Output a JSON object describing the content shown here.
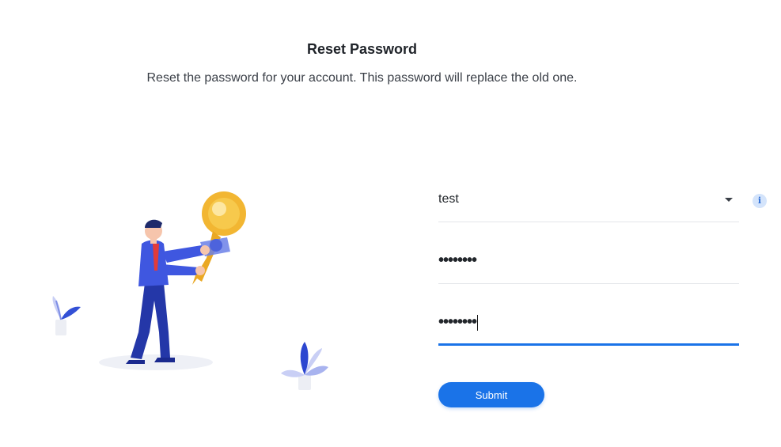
{
  "header": {
    "title": "Reset Password",
    "subtitle": "Reset the password for your account. This password will replace the old one."
  },
  "form": {
    "username": {
      "value": "test"
    },
    "new_password": {
      "masked_value": "••••••••"
    },
    "confirm_password": {
      "masked_value": "••••••••"
    },
    "submit_label": "Submit"
  },
  "icons": {
    "info": "info-icon",
    "dropdown": "chevron-down-icon",
    "illustration": "key-illustration"
  },
  "colors": {
    "accent": "#1a73e8",
    "info_bg": "#d4e4fb"
  }
}
